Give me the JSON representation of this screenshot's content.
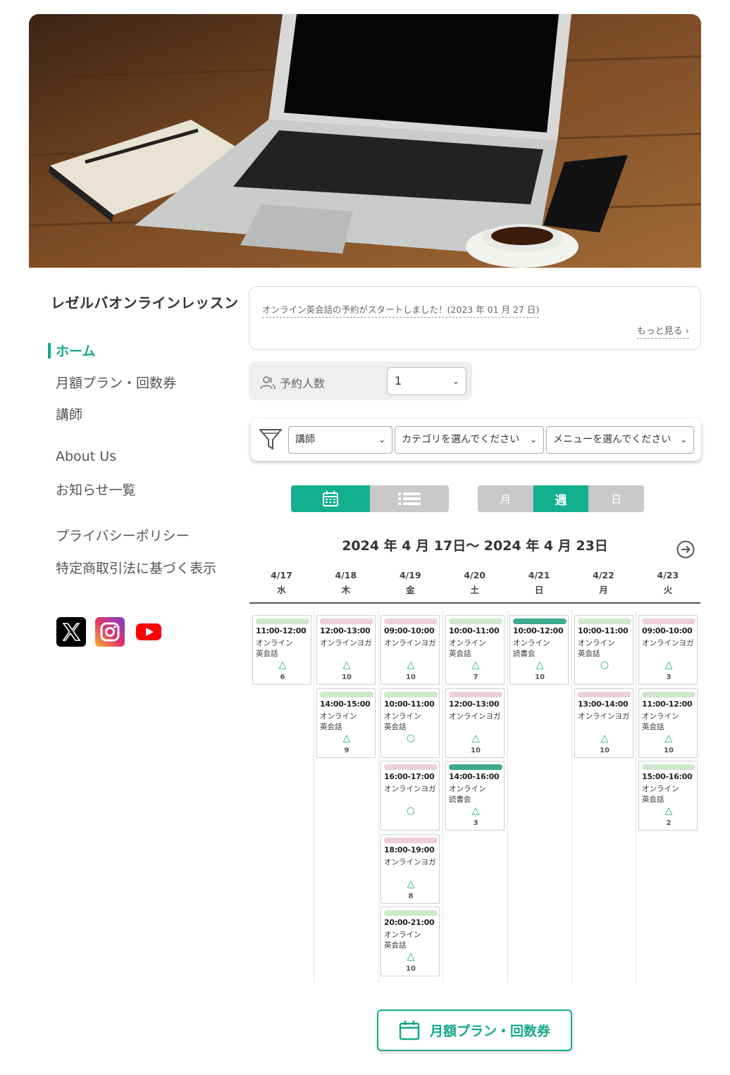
{
  "site": {
    "title": "レゼルバオンラインレッスン"
  },
  "nav": {
    "home": "ホーム",
    "plans": "月額プラン・回数券",
    "teachers": "講師",
    "about": "About Us",
    "news": "お知らせ一覧",
    "privacy": "プライバシーポリシー",
    "legal": "特定商取引法に基づく表示"
  },
  "social": [
    "x-icon",
    "instagram-icon",
    "youtube-icon"
  ],
  "notice": {
    "text": "オンライン英会話の予約がスタートしました！(2023 年 01 月 27 日)",
    "more": "もっと見る"
  },
  "people": {
    "label": "予約人数",
    "value": "1"
  },
  "filters": {
    "teacher": "講師",
    "category": "カテゴリを選んでください",
    "menu": "メニューを選んでください"
  },
  "range_tabs": {
    "month": "月",
    "week": "週",
    "day": "日"
  },
  "week_title": "2024 年 4 月 17日〜 2024 年 4 月 23日",
  "colors": {
    "accent": "#13b08f",
    "eng": "#cfe8cc",
    "yoga": "#ecd0da",
    "reading": "#3daa8f"
  },
  "days": [
    {
      "date": "4/17",
      "dow": "水"
    },
    {
      "date": "4/18",
      "dow": "木"
    },
    {
      "date": "4/19",
      "dow": "金"
    },
    {
      "date": "4/20",
      "dow": "土"
    },
    {
      "date": "4/21",
      "dow": "日"
    },
    {
      "date": "4/22",
      "dow": "月"
    },
    {
      "date": "4/23",
      "dow": "火"
    }
  ],
  "events": [
    [
      {
        "time": "11:00-12:00",
        "name": [
          "オンライン",
          "英会話"
        ],
        "type": "eng",
        "mark": "△",
        "count": "6"
      }
    ],
    [
      {
        "time": "12:00-13:00",
        "name": [
          "オンラインヨガ"
        ],
        "type": "yoga",
        "mark": "△",
        "count": "10"
      },
      {
        "time": "14:00-15:00",
        "name": [
          "オンライン",
          "英会話"
        ],
        "type": "eng",
        "mark": "△",
        "count": "9"
      }
    ],
    [
      {
        "time": "09:00-10:00",
        "name": [
          "オンラインヨガ"
        ],
        "type": "yoga",
        "mark": "△",
        "count": "10"
      },
      {
        "time": "10:00-11:00",
        "name": [
          "オンライン",
          "英会話"
        ],
        "type": "eng",
        "mark": "○",
        "count": ""
      },
      {
        "time": "16:00-17:00",
        "name": [
          "オンラインヨガ"
        ],
        "type": "yoga",
        "mark": "○",
        "count": ""
      },
      {
        "time": "18:00-19:00",
        "name": [
          "オンラインヨガ"
        ],
        "type": "yoga",
        "mark": "△",
        "count": "8"
      },
      {
        "time": "20:00-21:00",
        "name": [
          "オンライン",
          "英会話"
        ],
        "type": "eng",
        "mark": "△",
        "count": "10"
      }
    ],
    [
      {
        "time": "10:00-11:00",
        "name": [
          "オンライン",
          "英会話"
        ],
        "type": "eng",
        "mark": "△",
        "count": "7"
      },
      {
        "time": "12:00-13:00",
        "name": [
          "オンラインヨガ"
        ],
        "type": "yoga",
        "mark": "△",
        "count": "10"
      },
      {
        "time": "14:00-16:00",
        "name": [
          "オンライン",
          "読書会"
        ],
        "type": "reading",
        "mark": "△",
        "count": "3"
      }
    ],
    [
      {
        "time": "10:00-12:00",
        "name": [
          "オンライン",
          "読書会"
        ],
        "type": "reading",
        "mark": "△",
        "count": "10"
      }
    ],
    [
      {
        "time": "10:00-11:00",
        "name": [
          "オンライン",
          "英会話"
        ],
        "type": "eng",
        "mark": "○",
        "count": ""
      },
      {
        "time": "13:00-14:00",
        "name": [
          "オンラインヨガ"
        ],
        "type": "yoga",
        "mark": "△",
        "count": "10"
      }
    ],
    [
      {
        "time": "09:00-10:00",
        "name": [
          "オンラインヨガ"
        ],
        "type": "yoga",
        "mark": "△",
        "count": "3"
      },
      {
        "time": "11:00-12:00",
        "name": [
          "オンライン",
          "英会話"
        ],
        "type": "eng",
        "mark": "△",
        "count": "10"
      },
      {
        "time": "15:00-16:00",
        "name": [
          "オンライン",
          "英会話"
        ],
        "type": "eng",
        "mark": "△",
        "count": "2"
      }
    ]
  ],
  "plan_button": "月額プラン・回数券"
}
